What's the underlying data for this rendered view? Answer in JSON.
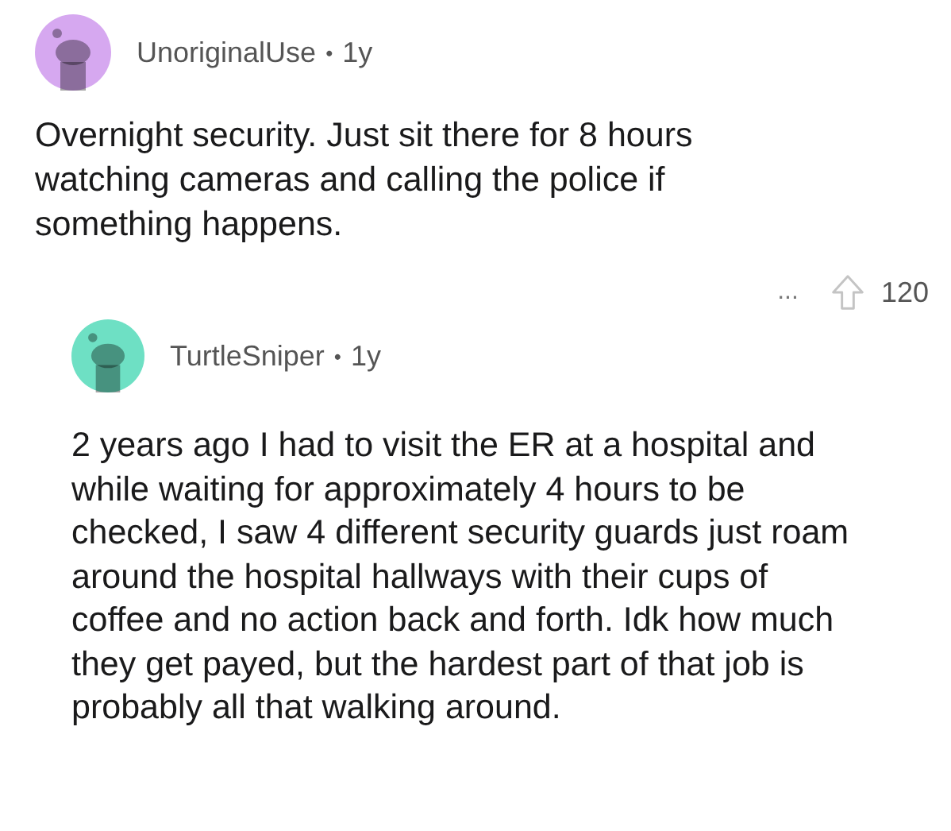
{
  "comments": [
    {
      "author": "UnoriginalUse",
      "separator": "•",
      "age": "1y",
      "color": "#d6a8f0",
      "body": "Overnight security. Just sit there for 8 hours watching cameras and calling the police if something happens.",
      "more": "...",
      "score": "120",
      "children": [
        {
          "author": "TurtleSniper",
          "separator": "•",
          "age": "1y",
          "color": "#6ee0c4",
          "body": "2 years ago I had to visit the ER at a hospital and while waiting for approximately 4 hours to be checked, I saw 4 different security guards just roam around the hospital hallways with their cups of coffee and no action back and forth.  Idk how much they get payed, but the hardest part of that job is probably all that walking around."
        }
      ]
    }
  ]
}
